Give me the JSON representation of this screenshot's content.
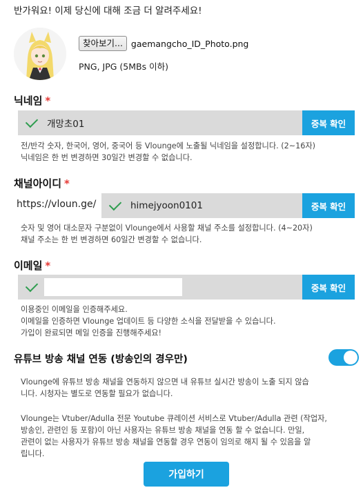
{
  "greeting": "반가워요! 이제 당신에 대해 조금 더 알려주세요!",
  "profile": {
    "avatar_icon": "anime-character-avatar",
    "file_button": "찾아보기...",
    "file_name": "gaemangcho_ID_Photo.png",
    "file_hint": "PNG, JPG (5MBs 이하)"
  },
  "nickname": {
    "label": "닉네임",
    "required": "*",
    "value": "개망초01",
    "confirm": "중복 확인",
    "help": [
      "전/반각 숫자, 한국어, 영어, 중국어 등 Vlounge에 노출될 닉네임을 설정합니다. (2~16자)",
      "닉네임은 한 번 변경하면 30일간 변경할 수 없습니다."
    ]
  },
  "channel": {
    "label": "채널아이디",
    "required": "*",
    "prefix": "https://vloun.ge/",
    "value": "himejyoon0101",
    "confirm": "중복 확인",
    "help": [
      "숫자 및 영어 대소문자 구분없이 Vlounge에서 사용할 채널 주소를 설정합니다. (4~20자)",
      "채널 주소는 한 번 변경하면 60일간 변경할 수 없습니다."
    ]
  },
  "email": {
    "label": "이메일",
    "required": "*",
    "confirm": "중복 확인",
    "help": [
      "이용중인 이메일을 인증해주세요.",
      "이메일을 인증하면 Vlounge 업데이트 등 다양한 소식을 전달받을 수 있습니다.",
      "가입이 완료되면 메일 인증을 진행해주세요!"
    ]
  },
  "youtube": {
    "title": "유튜브 방송 채널 연동 (방송인의 경우만)",
    "toggle_on": true,
    "help1": [
      "Vlounge에 유튜브 방송 채널을 연동하지 않으면 내 유튜브 실시간 방송이 노출 되지 않습",
      "니다. 시청자는 별도로 연동할 필요가 없습니다."
    ],
    "help2": [
      "Vlounge는 Vtuber/Adulla 전문 Youtube 큐레이션 서비스로 Vtuber/Adulla 관련 (작업자,",
      "방송인, 관련인 등 포함)이 아닌 사용자는 유튜브 방송 채널을 연동 할 수 없습니다. 만일,",
      "관련이 없는 사용자가 유튜브 방송 채널을 연동할 경우 연동이 임의로 해지 될 수 있음을 알",
      "립니다."
    ]
  },
  "signup": "가입하기",
  "colors": {
    "accent": "#1ba2df",
    "required": "#e53935",
    "check": "#2e9d4f",
    "field_bg": "#dadada"
  }
}
